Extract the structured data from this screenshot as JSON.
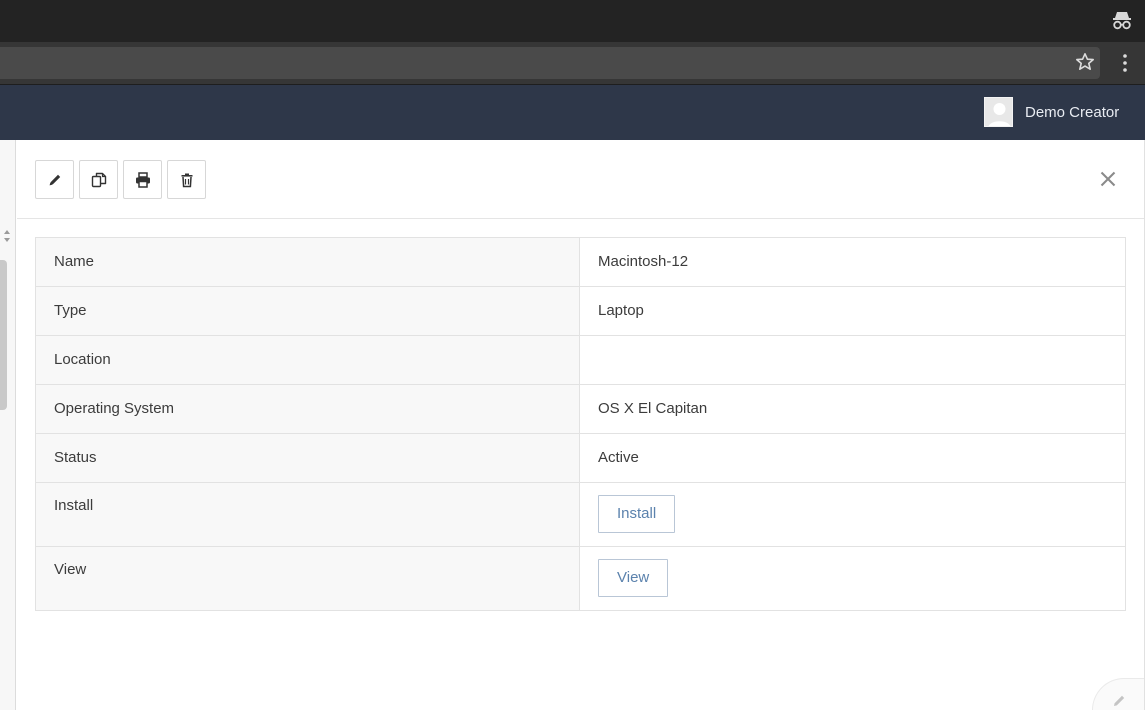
{
  "header": {
    "user_name": "Demo Creator"
  },
  "toolbar": {
    "buttons": [
      {
        "icon": "pencil-icon"
      },
      {
        "icon": "copy-icon"
      },
      {
        "icon": "print-icon"
      },
      {
        "icon": "trash-icon"
      }
    ],
    "close_icon": "close-icon"
  },
  "details": {
    "rows": [
      {
        "label": "Name",
        "value": "Macintosh-12"
      },
      {
        "label": "Type",
        "value": "Laptop"
      },
      {
        "label": "Location",
        "value": ""
      },
      {
        "label": "Operating System",
        "value": "OS X El Capitan"
      },
      {
        "label": "Status",
        "value": "Active"
      },
      {
        "label": "Install",
        "button": "Install"
      },
      {
        "label": "View",
        "button": "View"
      }
    ]
  },
  "colors": {
    "header_bg": "#2e3749",
    "button_text": "#5b82ad",
    "label_bg": "#f8f8f8"
  }
}
